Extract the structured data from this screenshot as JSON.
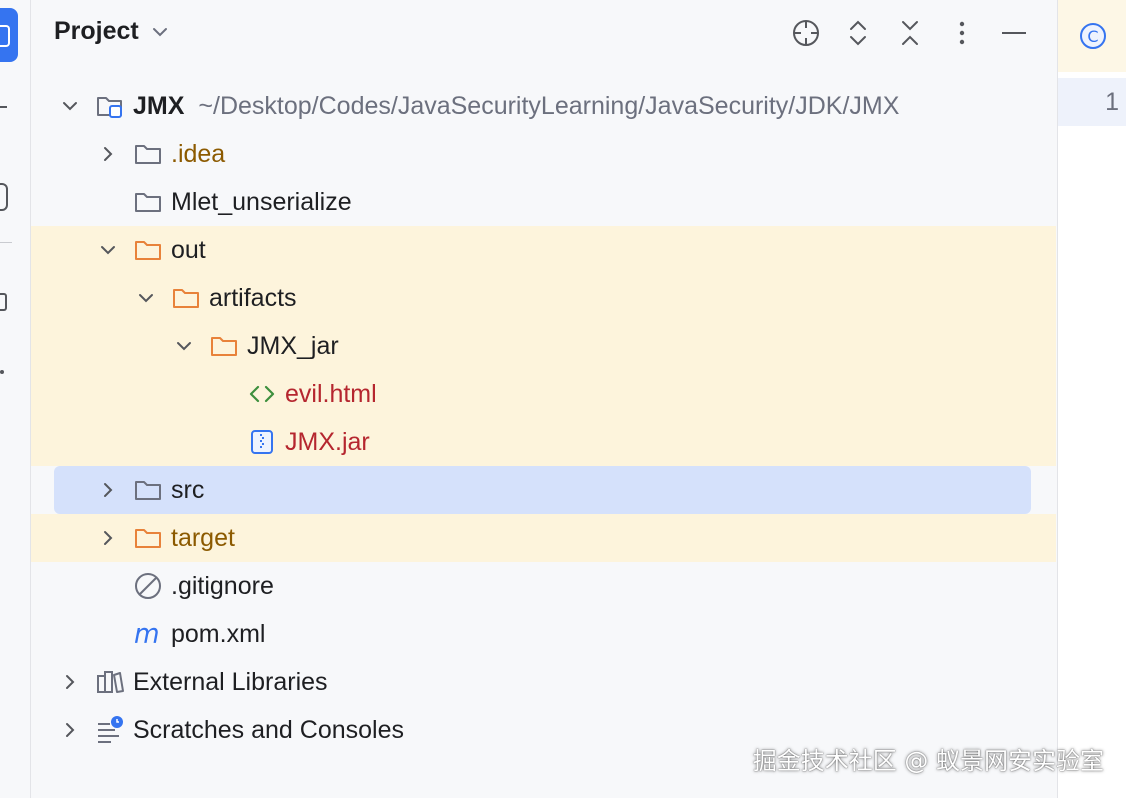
{
  "panel": {
    "title": "Project"
  },
  "tree": {
    "root": {
      "label": "JMX",
      "path": "~/Desktop/Codes/JavaSecurityLearning/JavaSecurity/JDK/JMX"
    },
    "idea": {
      "label": ".idea"
    },
    "mlet": {
      "label": "Mlet_unserialize"
    },
    "out": {
      "label": "out"
    },
    "artifacts": {
      "label": "artifacts"
    },
    "jmx_jar_dir": {
      "label": "JMX_jar"
    },
    "evil": {
      "label": "evil.html"
    },
    "jmx_jar": {
      "label": "JMX.jar"
    },
    "src": {
      "label": "src"
    },
    "target": {
      "label": "target"
    },
    "gitignore": {
      "label": ".gitignore"
    },
    "pom": {
      "label": "pom.xml"
    },
    "ext_libs": {
      "label": "External Libraries"
    },
    "scratches": {
      "label": "Scratches and Consoles"
    }
  },
  "editor": {
    "line_number": "1"
  },
  "watermark": "掘金技术社区 @ 蚁景网安实验室",
  "colors": {
    "excluded_bg": "#fdf4dc",
    "selection_bg": "#d5e1fb",
    "excluded_text": "#8c5a00",
    "unversioned_text": "#b5262f",
    "accent": "#3574f0"
  }
}
